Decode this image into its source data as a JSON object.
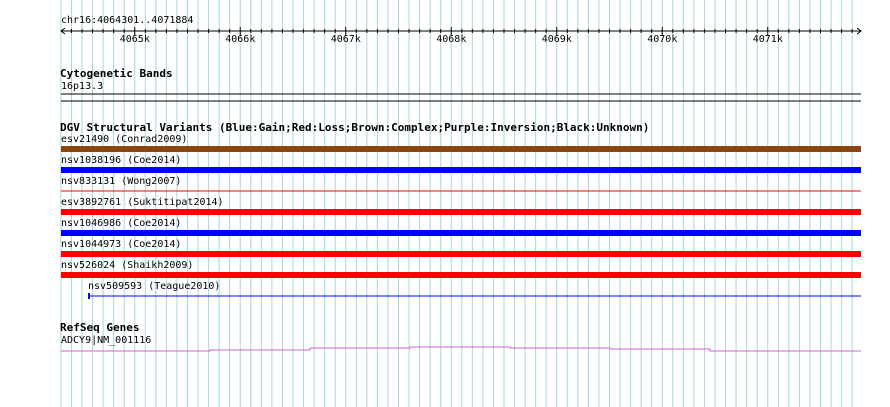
{
  "location": "chr16:4064301..4071884",
  "ruler": {
    "ticks": [
      {
        "label": "4065k",
        "pos": 4065000
      },
      {
        "label": "4066k",
        "pos": 4066000
      },
      {
        "label": "4067k",
        "pos": 4067000
      },
      {
        "label": "4068k",
        "pos": 4068000
      },
      {
        "label": "4069k",
        "pos": 4069000
      },
      {
        "label": "4070k",
        "pos": 4070000
      },
      {
        "label": "4071k",
        "pos": 4071000
      }
    ]
  },
  "cytoband": {
    "title": "Cytogenetic Bands",
    "band_label": "16p13.3"
  },
  "dgv": {
    "title": "DGV Structural Variants (Blue:Gain;Red:Loss;Brown:Complex;Purple:Inversion;Black:Unknown)",
    "colors": {
      "gain": "#0000ff",
      "loss": "#ff0000",
      "complex": "#8b4513",
      "unknown": "#000000"
    },
    "variants": [
      {
        "id": "esv21490",
        "study": "(Conrad2009)",
        "type": "complex",
        "thick": true,
        "full": true
      },
      {
        "id": "nsv1038196",
        "study": "(Coe2014)",
        "type": "gain",
        "thick": true,
        "full": true
      },
      {
        "id": "nsv833131",
        "study": "(Wong2007)",
        "type": "loss",
        "thick": false,
        "full": true
      },
      {
        "id": "esv3892761",
        "study": "(Suktitipat2014)",
        "type": "loss",
        "thick": true,
        "full": true
      },
      {
        "id": "nsv1046986",
        "study": "(Coe2014)",
        "type": "gain",
        "thick": true,
        "full": true
      },
      {
        "id": "nsv1044973",
        "study": "(Coe2014)",
        "type": "loss",
        "thick": true,
        "full": true
      },
      {
        "id": "nsv526024",
        "study": "(Shaikh2009)",
        "type": "loss",
        "thick": true,
        "full": true
      },
      {
        "id": "nsv509593",
        "study": "(Teague2010)",
        "type": "gain",
        "thick": false,
        "full": false
      }
    ]
  },
  "refseq": {
    "title": "RefSeq Genes",
    "gene_label": "ADCY9|NM_001116",
    "color": "#cc66cc"
  },
  "gridColor": "#aad4dd"
}
